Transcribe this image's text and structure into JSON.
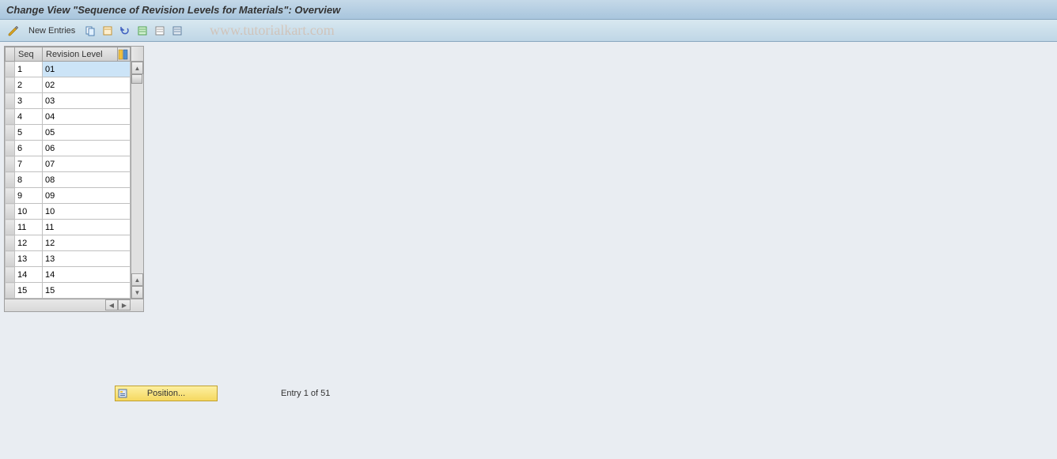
{
  "header": {
    "title": "Change View \"Sequence of Revision Levels for Materials\": Overview"
  },
  "toolbar": {
    "new_entries_label": "New Entries"
  },
  "watermark": "www.tutorialkart.com",
  "table": {
    "columns": {
      "seq": "Seq",
      "revision_level": "Revision Level"
    },
    "rows": [
      {
        "seq": "1",
        "rev": "01",
        "selected": true
      },
      {
        "seq": "2",
        "rev": "02",
        "selected": false
      },
      {
        "seq": "3",
        "rev": "03",
        "selected": false
      },
      {
        "seq": "4",
        "rev": "04",
        "selected": false
      },
      {
        "seq": "5",
        "rev": "05",
        "selected": false
      },
      {
        "seq": "6",
        "rev": "06",
        "selected": false
      },
      {
        "seq": "7",
        "rev": "07",
        "selected": false
      },
      {
        "seq": "8",
        "rev": "08",
        "selected": false
      },
      {
        "seq": "9",
        "rev": "09",
        "selected": false
      },
      {
        "seq": "10",
        "rev": "10",
        "selected": false
      },
      {
        "seq": "11",
        "rev": "11",
        "selected": false
      },
      {
        "seq": "12",
        "rev": "12",
        "selected": false
      },
      {
        "seq": "13",
        "rev": "13",
        "selected": false
      },
      {
        "seq": "14",
        "rev": "14",
        "selected": false
      },
      {
        "seq": "15",
        "rev": "15",
        "selected": false
      }
    ]
  },
  "footer": {
    "position_label": "Position...",
    "entry_text": "Entry 1 of 51"
  }
}
